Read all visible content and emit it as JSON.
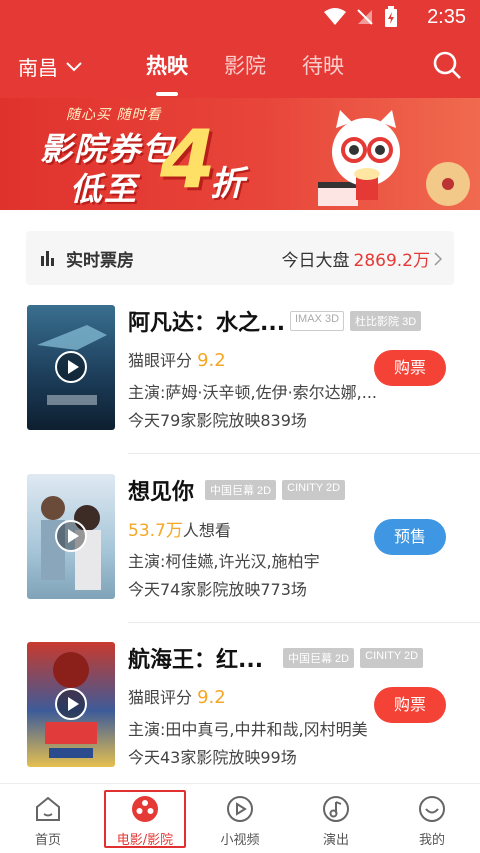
{
  "status_bar": {
    "time": "2:35"
  },
  "header": {
    "city": "南昌",
    "tabs": [
      {
        "label": "热映",
        "active": true
      },
      {
        "label": "影院",
        "active": false
      },
      {
        "label": "待映",
        "active": false
      }
    ]
  },
  "banner": {
    "slogan": "随心买 随时看",
    "line1": "影院券包",
    "line2": "低至",
    "number": "4",
    "suffix": "折"
  },
  "box_office": {
    "label": "实时票房",
    "total_label": "今日大盘",
    "total_value": "2869.2万"
  },
  "movies": [
    {
      "title": "阿凡达：水之...",
      "tags": [
        "IMAX 3D",
        "杜比影院 3D"
      ],
      "score_label": "猫眼评分",
      "score": "9.2",
      "cast": "主演:萨姆·沃辛顿,佐伊·索尔达娜,...",
      "showing": "今天79家影院放映839场",
      "button": "购票",
      "button_type": "buy"
    },
    {
      "title": "想见你",
      "tags": [
        "中国巨幕 2D",
        "CINITY 2D"
      ],
      "want_count": "53.7万",
      "want_label": "人想看",
      "cast": "主演:柯佳嬿,许光汉,施柏宇",
      "showing": "今天74家影院放映773场",
      "button": "预售",
      "button_type": "presale"
    },
    {
      "title": "航海王：红...",
      "tags": [
        "中国巨幕 2D",
        "CINITY 2D"
      ],
      "score_label": "猫眼评分",
      "score": "9.2",
      "cast": "主演:田中真弓,中井和哉,冈村明美",
      "showing": "今天43家影院放映99场",
      "button": "购票",
      "button_type": "buy"
    }
  ],
  "bottom_nav": [
    {
      "label": "首页",
      "icon": "home-icon",
      "active": false
    },
    {
      "label": "电影/影院",
      "icon": "film-reel-icon",
      "active": true
    },
    {
      "label": "小视频",
      "icon": "play-circle-icon",
      "active": false
    },
    {
      "label": "演出",
      "icon": "music-note-icon",
      "active": false
    },
    {
      "label": "我的",
      "icon": "profile-icon",
      "active": false
    }
  ],
  "colors": {
    "brand_red": "#e53935",
    "score_orange": "#f5a623",
    "presale_blue": "#3f96e2"
  }
}
